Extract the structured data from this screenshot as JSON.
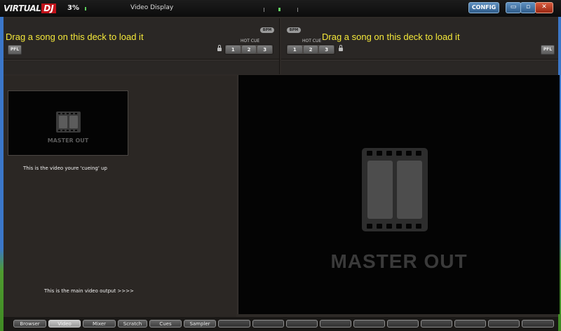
{
  "app": {
    "logo_part1": "VIRTUAL",
    "logo_part2": "DJ",
    "cpu_load": "3%",
    "title": "Video Display"
  },
  "window": {
    "config_label": "CONFIG",
    "minimize_symbol": "▭",
    "maximize_symbol": "▫",
    "close_symbol": "✕"
  },
  "deck_left": {
    "bpm_label": "BPM",
    "message": "Drag a song on this deck to load it",
    "pfl_label": "PFL",
    "hotcue_label": "HOT CUE",
    "hotcues": [
      "1",
      "2",
      "3"
    ]
  },
  "deck_right": {
    "bpm_label": "BPM",
    "message": "Drag a song on this deck to load it",
    "pfl_label": "PFL",
    "hotcue_label": "HOT CUE",
    "hotcues": [
      "1",
      "2",
      "3"
    ]
  },
  "video": {
    "preview_label": "MASTER OUT",
    "cue_caption": "This is the video youre 'cueing' up",
    "main_caption": "This is the main video output >>>>",
    "master_label": "MASTER OUT"
  },
  "tabs": [
    "Browser",
    "Video",
    "Mixer",
    "Scratch",
    "Cues",
    "Sampler"
  ],
  "active_tab": "Video",
  "colors": {
    "deck_message": "#f4e83a",
    "logo_red": "#c1121a",
    "background": "#2e2a27"
  }
}
